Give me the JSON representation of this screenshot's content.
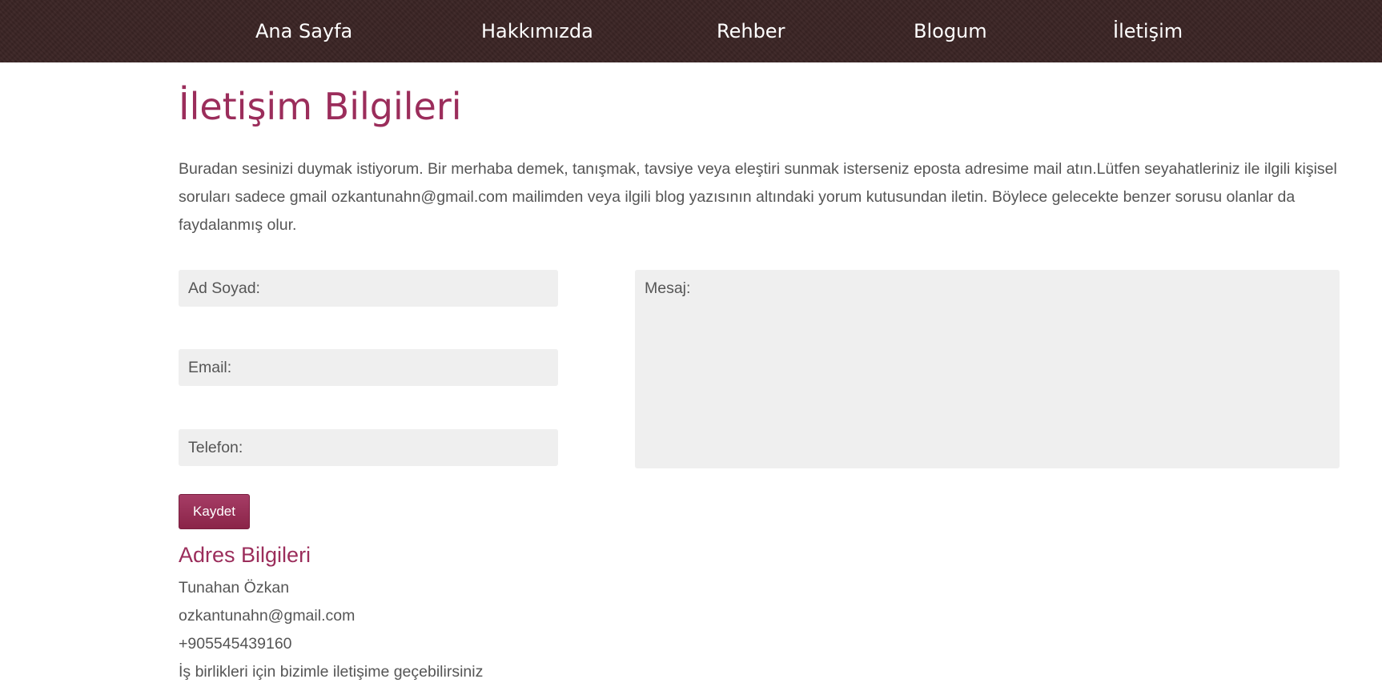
{
  "nav": {
    "items": [
      {
        "label": "Ana Sayfa"
      },
      {
        "label": "Hakkımızda"
      },
      {
        "label": "Rehber"
      },
      {
        "label": "Blogum"
      },
      {
        "label": "İletişim"
      }
    ]
  },
  "page": {
    "title": "İletişim Bilgileri",
    "intro": "Buradan sesinizi duymak istiyorum. Bir merhaba demek, tanışmak, tavsiye veya eleştiri sunmak isterseniz eposta adresime mail atın.Lütfen seyahatleriniz ile ilgili kişisel soruları sadece gmail ozkantunahn@gmail.com mailimden veya ilgili blog yazısının altındaki yorum kutusundan iletin. Böylece gelecekte benzer sorusu olanlar da faydalanmış olur."
  },
  "form": {
    "name_placeholder": "Ad Soyad:",
    "email_placeholder": "Email:",
    "phone_placeholder": "Telefon:",
    "message_placeholder": "Mesaj:",
    "submit_label": "Kaydet"
  },
  "address": {
    "title": "Adres Bilgileri",
    "name": "Tunahan Özkan",
    "email": "ozkantunahn@gmail.com",
    "phone": "+905545439160",
    "note": "İş birlikleri için bizimle iletişime geçebilirsiniz"
  },
  "colors": {
    "navbar_bg": "#3a2424",
    "accent": "#9b2d5b",
    "button": "#8a2448",
    "input_bg": "#efefef",
    "text": "#555555"
  }
}
